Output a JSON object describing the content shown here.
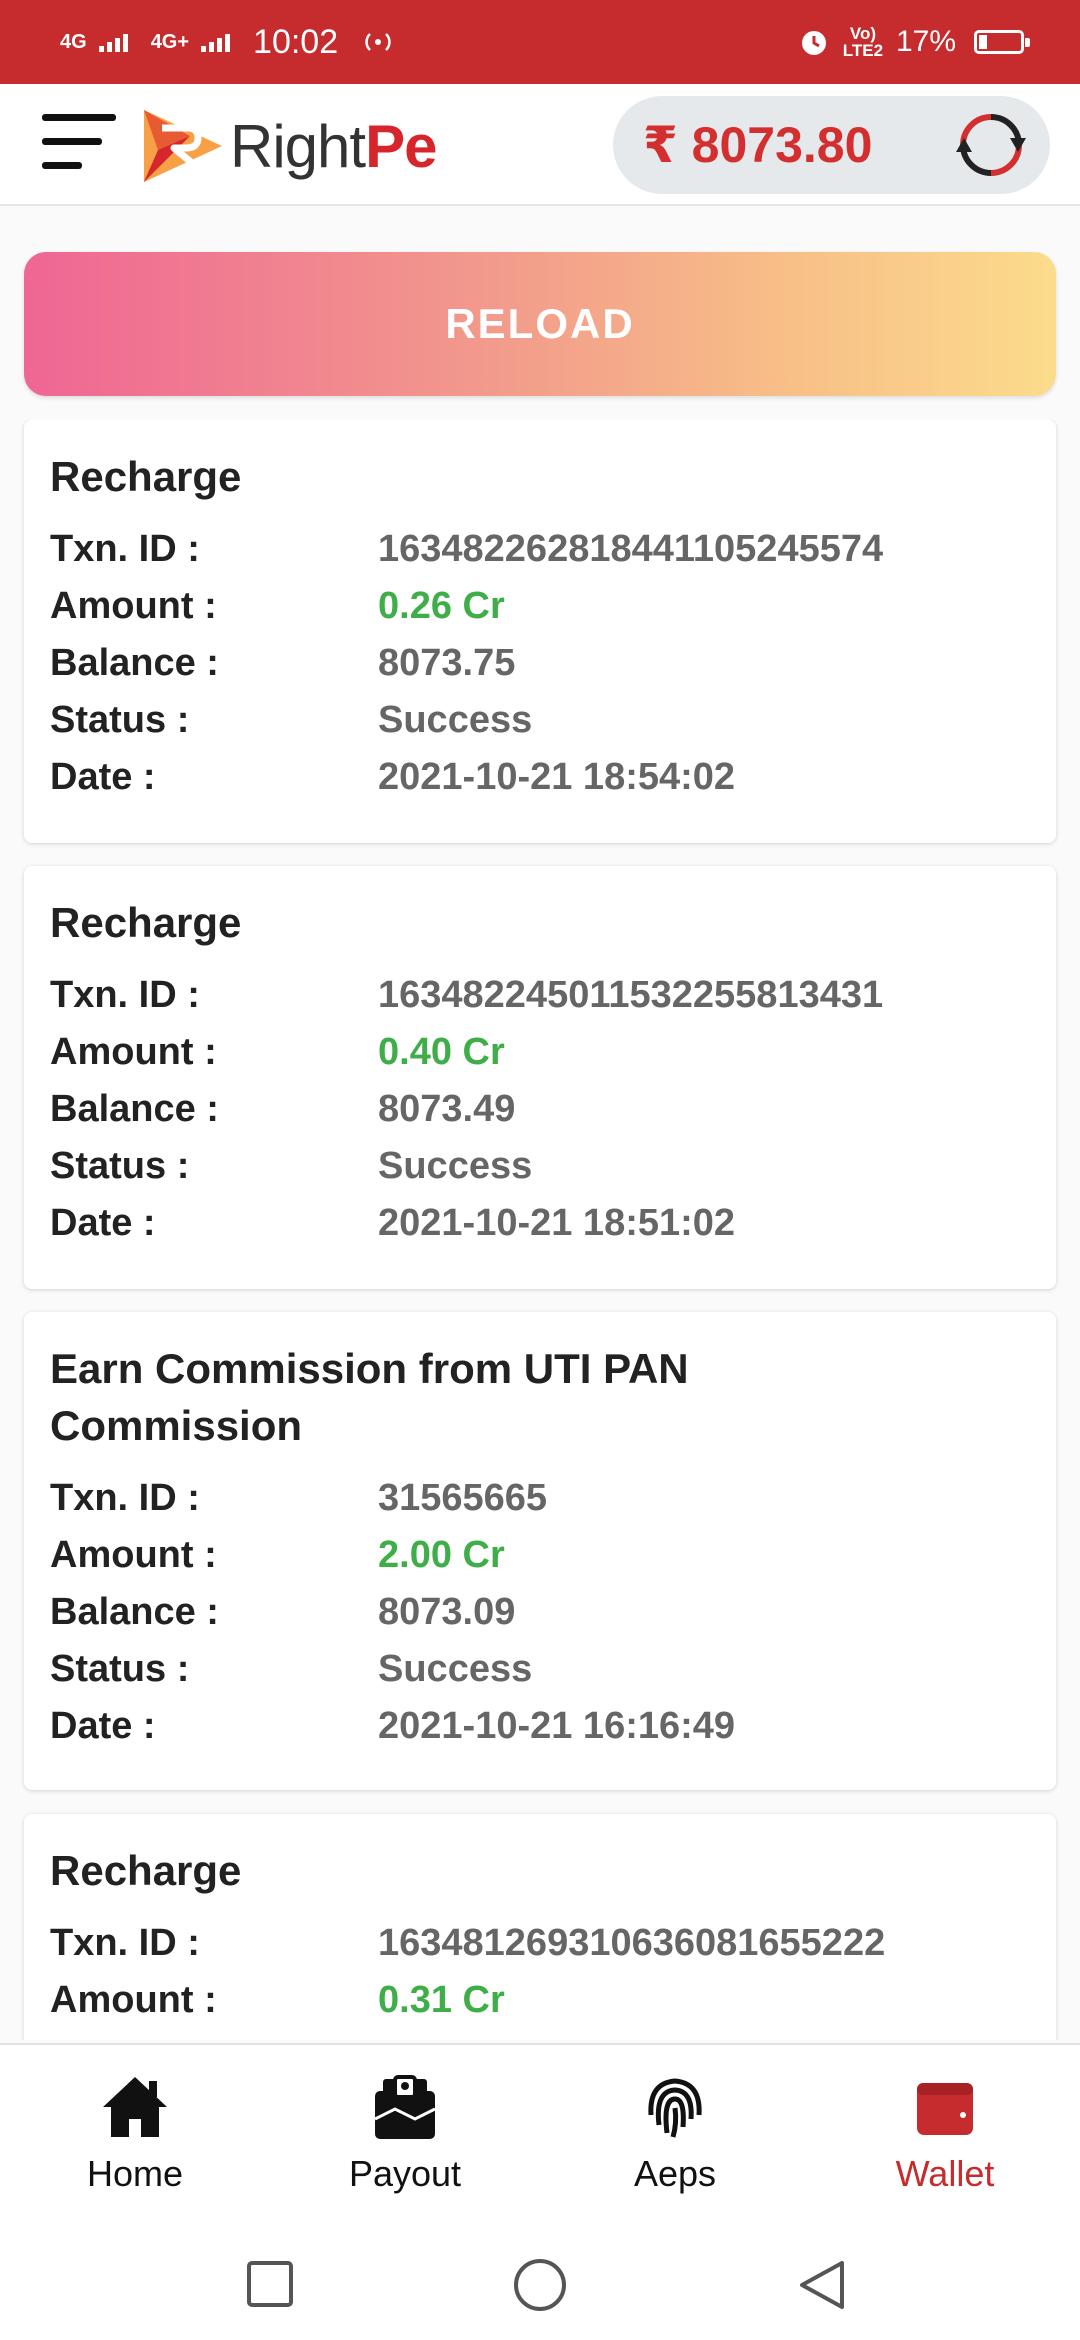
{
  "status_bar": {
    "network_1": "4G",
    "network_2": "4G+",
    "time": "10:02",
    "volte": "Vo) LTE2",
    "battery": "17%"
  },
  "header": {
    "logo_right": "Right",
    "logo_pe": "Pe",
    "balance": "₹ 8073.80"
  },
  "reload_label": "RELOAD",
  "labels": {
    "txn_id": "Txn. ID :",
    "amount": "Amount :",
    "balance": "Balance :",
    "status": "Status :",
    "date": "Date :"
  },
  "transactions": [
    {
      "title": "Recharge",
      "txn_id": "163482262818441105245574",
      "amount": "0.26 Cr",
      "balance": "8073.75",
      "status": "Success",
      "date": "2021-10-21 18:54:02"
    },
    {
      "title": "Recharge",
      "txn_id": "163482245011532255813431",
      "amount": "0.40 Cr",
      "balance": "8073.49",
      "status": "Success",
      "date": "2021-10-21 18:51:02"
    },
    {
      "title": "Earn Commission from  UTI PAN Commission",
      "txn_id": "31565665",
      "amount": "2.00 Cr",
      "balance": "8073.09",
      "status": "Success",
      "date": "2021-10-21 16:16:49"
    },
    {
      "title": "Recharge",
      "txn_id": "163481269310636081655222",
      "amount": "0.31 Cr",
      "balance": "",
      "status": "",
      "date": ""
    }
  ],
  "bottom_nav": [
    {
      "label": "Home",
      "icon": "home-icon"
    },
    {
      "label": "Payout",
      "icon": "payout-icon"
    },
    {
      "label": "Aeps",
      "icon": "fingerprint-icon"
    },
    {
      "label": "Wallet",
      "icon": "wallet-icon",
      "active": true
    }
  ],
  "colors": {
    "brand_red": "#c62b2e",
    "amount_green": "#3fae49",
    "balance_red": "#d32f2f"
  }
}
